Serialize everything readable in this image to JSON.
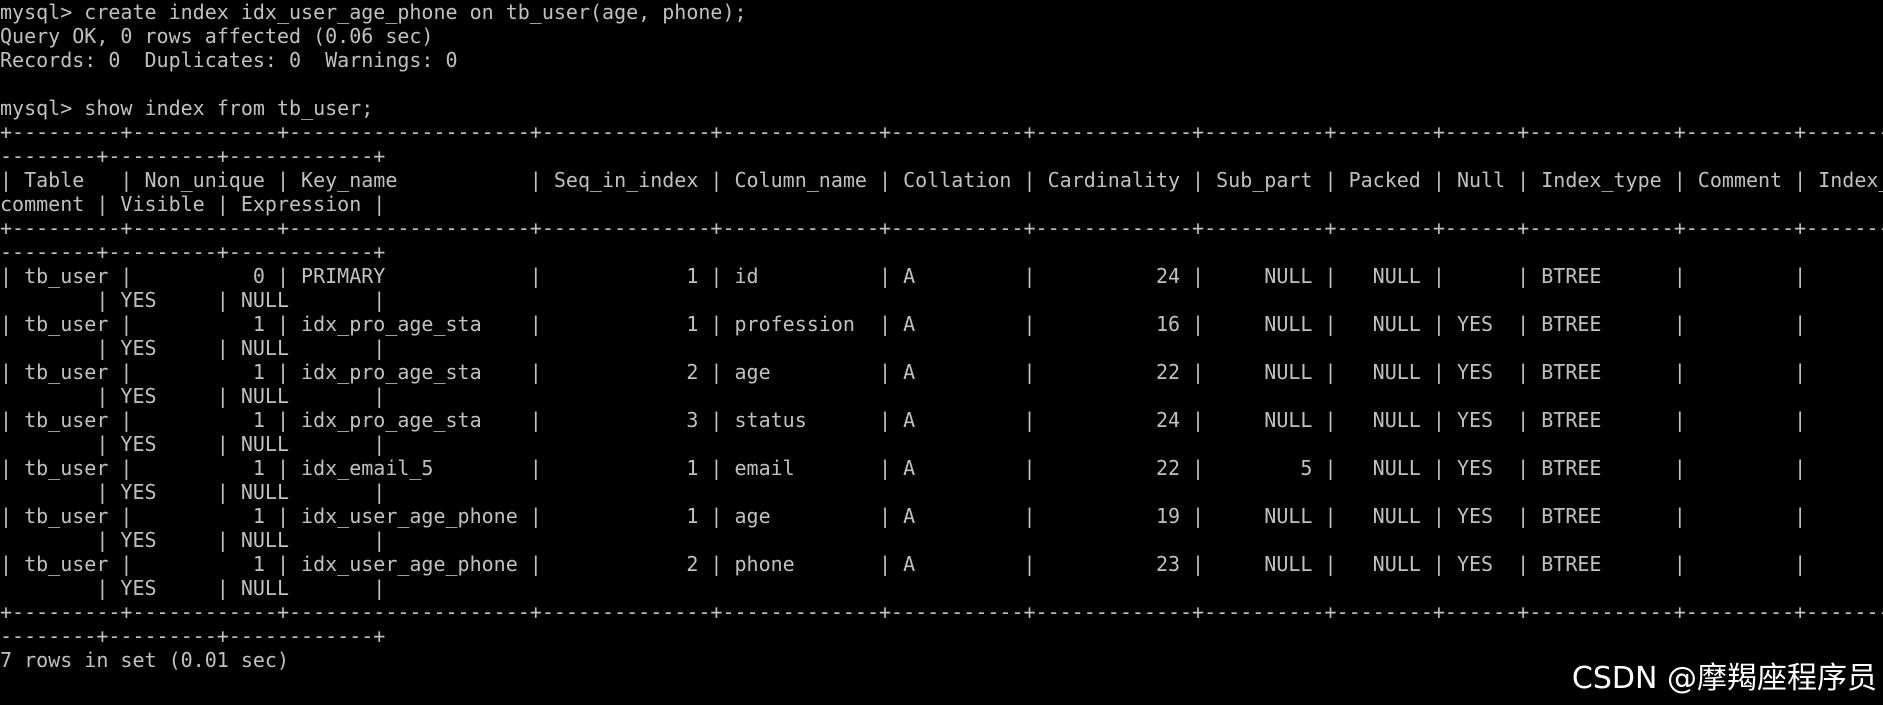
{
  "terminal": {
    "colors": {
      "background": "#000000",
      "foreground": "#c0c0c0",
      "watermark": "#ffffff"
    },
    "lines": [
      "mysql> create index idx_user_age_phone on tb_user(age, phone);",
      "Query OK, 0 rows affected (0.06 sec)",
      "Records: 0  Duplicates: 0  Warnings: 0",
      "",
      "mysql> show index from tb_user;",
      "+---------+------------+--------------------+--------------+-------------+-----------+-------------+----------+--------+------+------------+---------+---------------",
      "--------+---------+------------+",
      "| Table   | Non_unique | Key_name           | Seq_in_index | Column_name | Collation | Cardinality | Sub_part | Packed | Null | Index_type | Comment | Index_",
      "comment | Visible | Expression |",
      "+---------+------------+--------------------+--------------+-------------+-----------+-------------+----------+--------+------+------------+---------+---------------",
      "--------+---------+------------+",
      "| tb_user |          0 | PRIMARY            |            1 | id          | A         |          24 |     NULL |   NULL |      | BTREE      |         |",
      "        | YES     | NULL       |",
      "| tb_user |          1 | idx_pro_age_sta    |            1 | profession  | A         |          16 |     NULL |   NULL | YES  | BTREE      |         |",
      "        | YES     | NULL       |",
      "| tb_user |          1 | idx_pro_age_sta    |            2 | age         | A         |          22 |     NULL |   NULL | YES  | BTREE      |         |",
      "        | YES     | NULL       |",
      "| tb_user |          1 | idx_pro_age_sta    |            3 | status      | A         |          24 |     NULL |   NULL | YES  | BTREE      |         |",
      "        | YES     | NULL       |",
      "| tb_user |          1 | idx_email_5        |            1 | email       | A         |          22 |        5 |   NULL | YES  | BTREE      |         |",
      "        | YES     | NULL       |",
      "| tb_user |          1 | idx_user_age_phone |            1 | age         | A         |          19 |     NULL |   NULL | YES  | BTREE      |         |",
      "        | YES     | NULL       |",
      "| tb_user |          1 | idx_user_age_phone |            2 | phone       | A         |          23 |     NULL |   NULL | YES  | BTREE      |         |",
      "        | YES     | NULL       |",
      "+---------+------------+--------------------+--------------+-------------+-----------+-------------+----------+--------+------+------------+---------+---------------",
      "--------+---------+------------+",
      "7 rows in set (0.01 sec)"
    ]
  },
  "watermark": {
    "text": "CSDN @摩羯座程序员"
  }
}
